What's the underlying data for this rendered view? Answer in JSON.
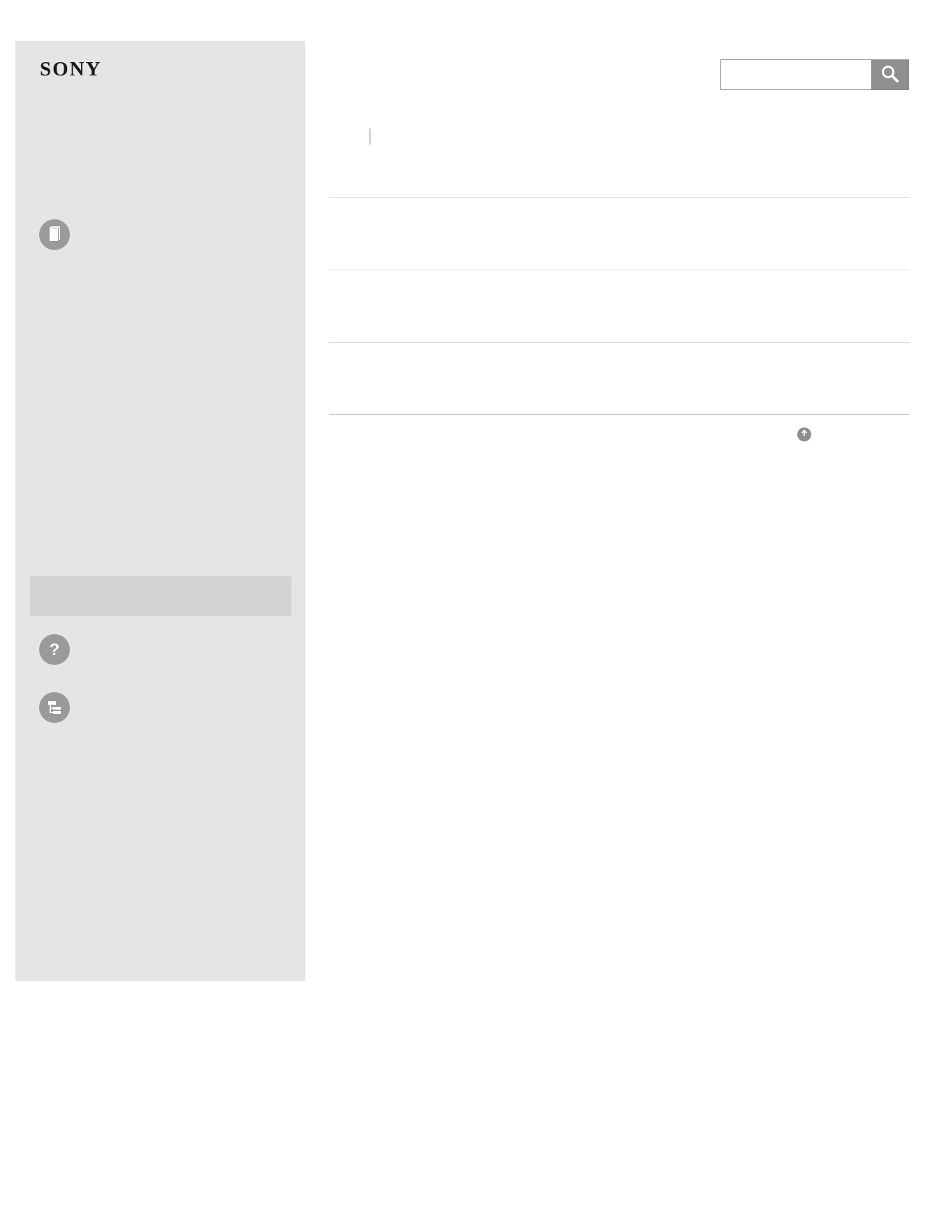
{
  "brand": {
    "logo_text": "SONY"
  },
  "search": {
    "placeholder": "",
    "value": "",
    "button_icon": "search-icon"
  },
  "sidebar": {
    "items": [
      {
        "icon": "book-icon",
        "label": ""
      },
      {
        "icon": "question-icon",
        "label": ""
      },
      {
        "icon": "tree-list-icon",
        "label": ""
      }
    ],
    "highlight_label": ""
  },
  "main": {
    "breadcrumb": [
      "",
      ""
    ],
    "rows": [
      "",
      "",
      ""
    ],
    "back_to_top": {
      "icon": "arrow-up-icon",
      "label": ""
    }
  },
  "colors": {
    "sidebar_bg": "#e5e5e5",
    "highlight_bg": "#d2d2d2",
    "icon_gray": "#9a9a9a",
    "search_button": "#8f8f8f"
  }
}
